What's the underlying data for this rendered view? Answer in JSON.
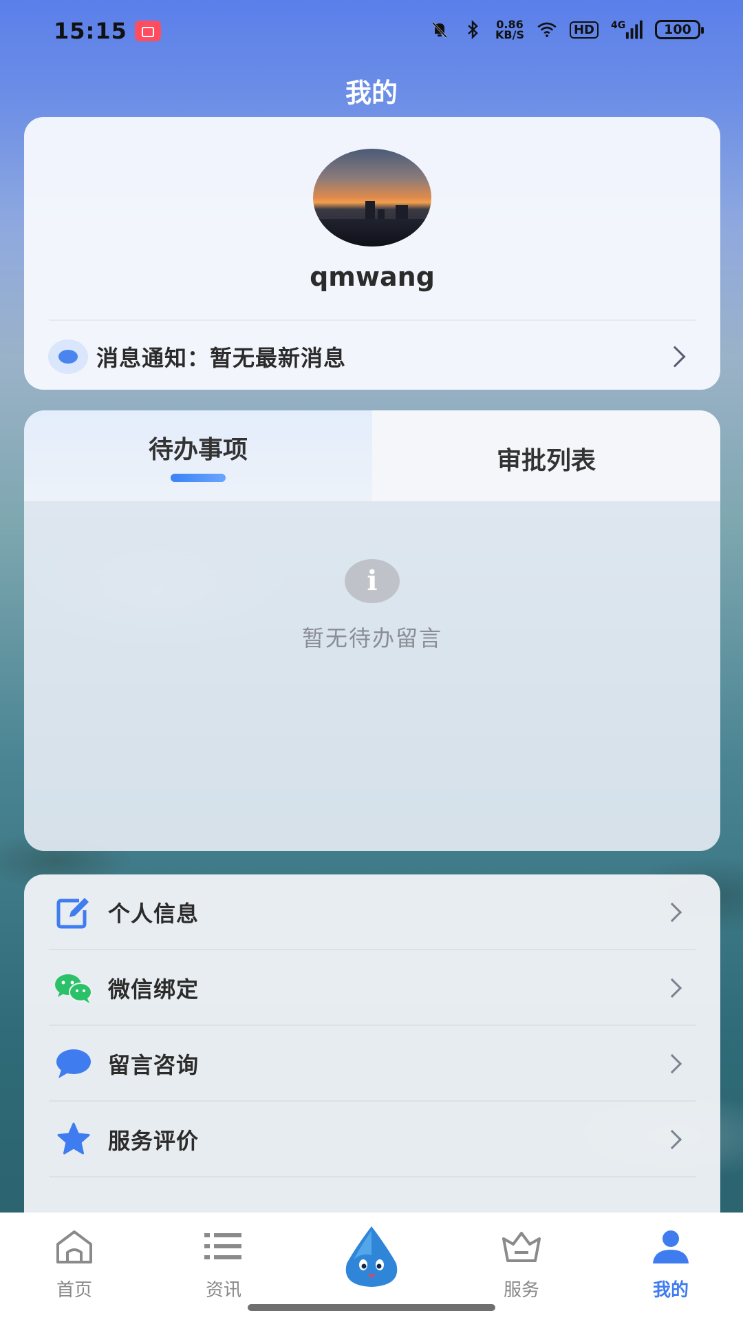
{
  "status_bar": {
    "time": "15:15",
    "speed_value": "0.86",
    "speed_unit": "KB/S",
    "hd_label": "HD",
    "network": "4G",
    "battery": "100"
  },
  "header": {
    "title": "我的"
  },
  "profile": {
    "username": "qmwang",
    "notification_text": "消息通知：暂无最新消息"
  },
  "todo": {
    "tabs": [
      {
        "label": "待办事项",
        "active": true
      },
      {
        "label": "审批列表",
        "active": false
      }
    ],
    "empty_text": "暂无待办留言"
  },
  "menu": {
    "items": [
      {
        "label": "个人信息",
        "icon": "edit-icon"
      },
      {
        "label": "微信绑定",
        "icon": "wechat-icon"
      },
      {
        "label": "留言咨询",
        "icon": "chat-bubble-icon"
      },
      {
        "label": "服务评价",
        "icon": "star-icon"
      }
    ]
  },
  "bottom_nav": {
    "items": [
      {
        "label": "首页",
        "icon": "home-icon",
        "active": false
      },
      {
        "label": "资讯",
        "icon": "list-icon",
        "active": false
      },
      {
        "label": "",
        "icon": "water-drop-mascot-icon",
        "active": false
      },
      {
        "label": "服务",
        "icon": "service-basket-icon",
        "active": false
      },
      {
        "label": "我的",
        "icon": "user-icon",
        "active": true
      }
    ]
  },
  "colors": {
    "accent": "#3f7cf0",
    "header_blue": "#5b7fea",
    "wechat_green": "#2bc168"
  }
}
